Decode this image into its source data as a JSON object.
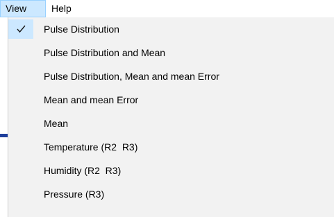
{
  "menubar": {
    "view_label": "View",
    "help_label": "Help"
  },
  "view_menu": {
    "items": [
      {
        "label": "Pulse Distribution",
        "checked": true
      },
      {
        "label": "Pulse Distribution and Mean",
        "checked": false
      },
      {
        "label": "Pulse Distribution, Mean and mean Error",
        "checked": false
      },
      {
        "label": "Mean and mean Error",
        "checked": false
      },
      {
        "label": "Mean",
        "checked": false
      },
      {
        "label": "Temperature (R2  R3)",
        "checked": false
      },
      {
        "label": "Humidity (R2  R3)",
        "checked": false
      },
      {
        "label": "Pressure (R3)",
        "checked": false
      }
    ]
  },
  "colors": {
    "highlight": "#cce8ff",
    "highlight_border": "#99d1ff",
    "menu_background": "#f2f2f2",
    "check_mark": "#1a1a1a",
    "side_mark": "#1e3f9c"
  },
  "icons": {
    "check": "check-icon"
  }
}
